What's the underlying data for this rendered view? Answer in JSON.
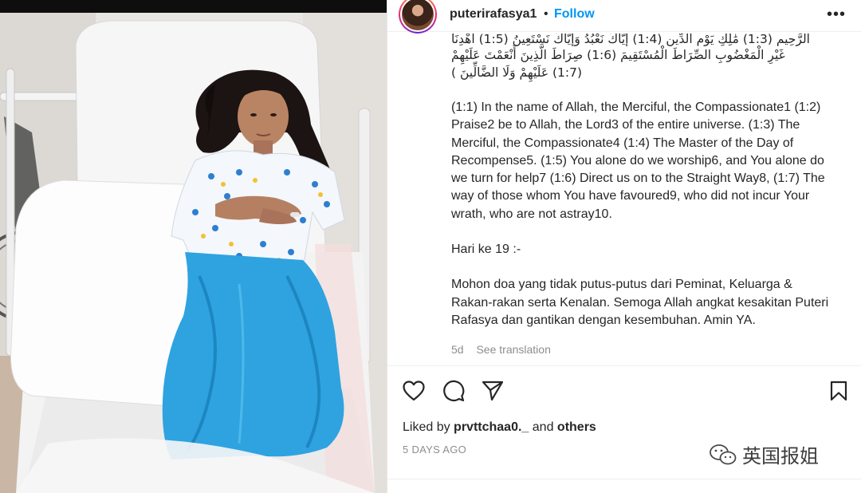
{
  "post": {
    "photo_alt": "photo",
    "header": {
      "username": "puterirafasya1",
      "separator": "•",
      "follow_label": "Follow",
      "more_label": "•••"
    },
    "caption": {
      "arabic_line_1": "الرَّحِيمِ (1:3) مَٰلِكِ يَوْمِ الدِّينِ (1:4) إِيَّاكَ نَعْبُدُ وَإِيَّاكَ نَسْتَعِينُ (1:5) اهْدِنَا",
      "arabic_line_2": "غَيْرِ الْمَغْضُوبِ الصِّرَاطَ الْمُسْتَقِيمَ (1:6) صِرَاطَ الَّذِينَ أَنْعَمْتَ عَلَيْهِمْ",
      "arabic_line_3": "(1:7) عَلَيْهِمْ وَلَا الضَّالِّينَ )",
      "translation": "(1:1) In the name of Allah, the Merciful, the Compassionate1 (1:2) Praise2 be to Allah, the Lord3 of the entire universe. (1:3) The Merciful, the Compassionate4 (1:4) The Master of the Day of Recompense5. (1:5) You alone do we worship6, and You alone do we turn for help7 (1:6) Direct us on to the Straight Way8, (1:7) The way of those whom You have favoured9, who did not incur Your wrath, who are not astray10.",
      "day_line": "Hari ke 19 :-",
      "prayer": "Mohon doa yang tidak putus-putus dari Peminat, Keluarga & Rakan-rakan serta Kenalan. Semoga Allah angkat kesakitan Puteri Rafasya dan gantikan dengan kesembuhan. Amin YA."
    },
    "meta": {
      "time_ago": "5d",
      "see_translation": "See translation"
    },
    "likes": {
      "prefix": "Liked by",
      "user": "prvttchaa0._",
      "conjunction": "and",
      "others": "others"
    },
    "date": "5 DAYS AGO",
    "watermark": "英国报姐",
    "icons": [
      "heart-icon",
      "comment-icon",
      "share-icon",
      "bookmark-icon",
      "more-icon",
      "wechat-icon"
    ],
    "colors": {
      "link": "#0095f6",
      "text": "#262626",
      "muted": "#8e8e8e",
      "gown": "#2ea3e0"
    }
  }
}
